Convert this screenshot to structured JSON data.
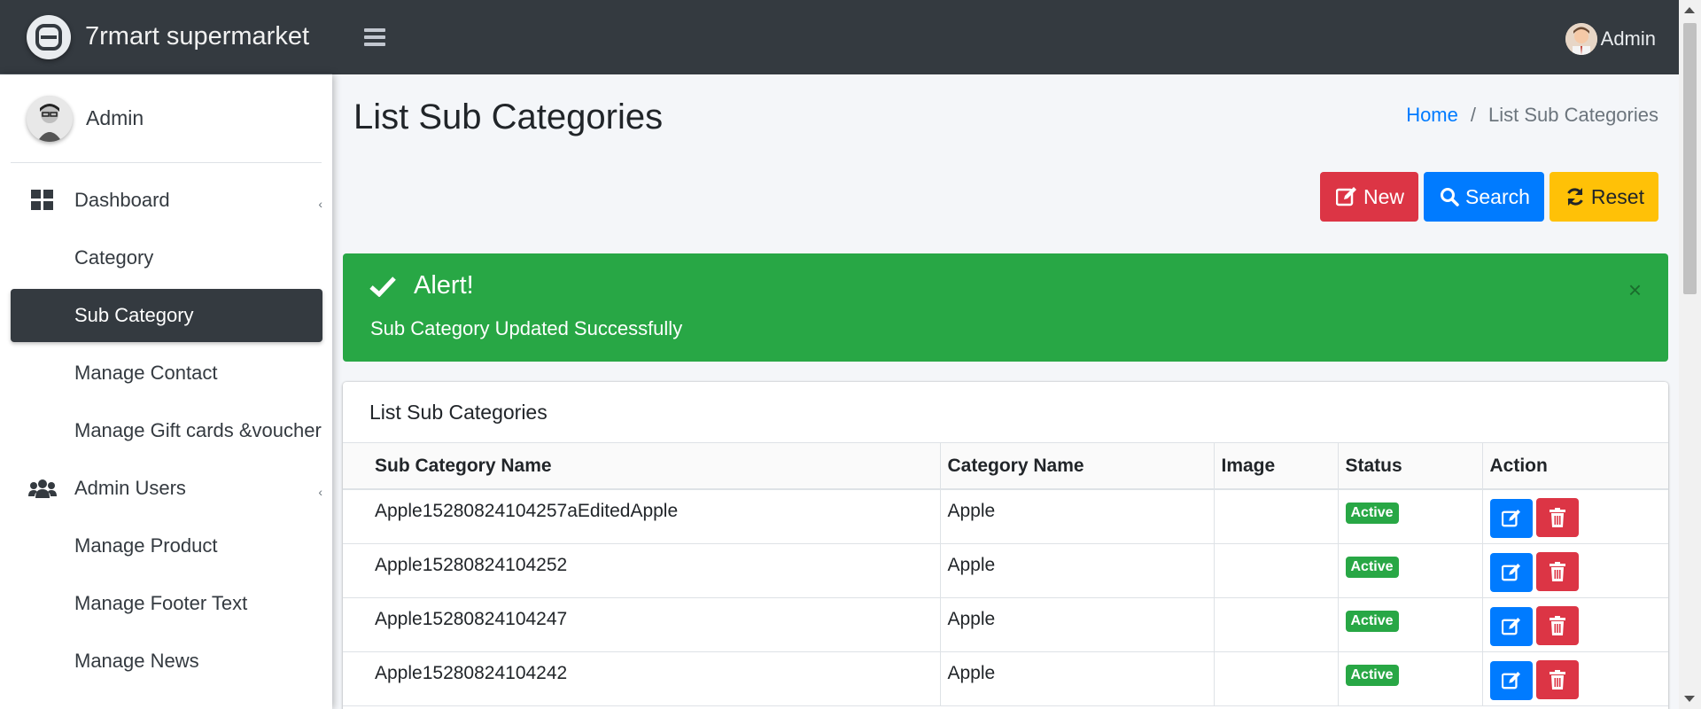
{
  "brand": {
    "name": "7rmart supermarket"
  },
  "sidebar": {
    "user": "Admin",
    "items": [
      {
        "label": "Dashboard"
      },
      {
        "label": "Category"
      },
      {
        "label": "Sub Category"
      },
      {
        "label": "Manage Contact"
      },
      {
        "label": "Manage Gift cards &voucher"
      },
      {
        "label": "Admin Users"
      },
      {
        "label": "Manage Product"
      },
      {
        "label": "Manage Footer Text"
      },
      {
        "label": "Manage News"
      }
    ]
  },
  "topbar": {
    "user": "Admin"
  },
  "page": {
    "title": "List Sub Categories",
    "breadcrumb": {
      "home": "Home",
      "separator": "/",
      "current": "List Sub Categories"
    }
  },
  "actions": {
    "new": "New",
    "search": "Search",
    "reset": "Reset"
  },
  "alert": {
    "title": "Alert!",
    "message": "Sub Category Updated Successfully",
    "close": "×"
  },
  "card": {
    "title": "List Sub Categories",
    "columns": [
      "Sub Category Name",
      "Category Name",
      "Image",
      "Status",
      "Action"
    ],
    "rows": [
      {
        "name": "Apple15280824104257aEditedApple",
        "category": "Apple",
        "image": "",
        "status": "Active"
      },
      {
        "name": "Apple15280824104252",
        "category": "Apple",
        "image": "",
        "status": "Active"
      },
      {
        "name": "Apple15280824104247",
        "category": "Apple",
        "image": "",
        "status": "Active"
      },
      {
        "name": "Apple15280824104242",
        "category": "Apple",
        "image": "",
        "status": "Active"
      }
    ]
  },
  "colors": {
    "sidebar_dark": "#343a40",
    "primary": "#007bff",
    "danger": "#dc3545",
    "warning": "#ffc107",
    "success": "#28a745"
  },
  "icons": {
    "brand": "brand-logo-icon",
    "menu": "hamburger-icon",
    "dashboard": "grid-icon",
    "users": "users-icon",
    "new": "edit-icon",
    "search": "search-icon",
    "reset": "refresh-icon",
    "alert": "check-icon",
    "edit": "edit-icon",
    "delete": "trash-icon"
  }
}
